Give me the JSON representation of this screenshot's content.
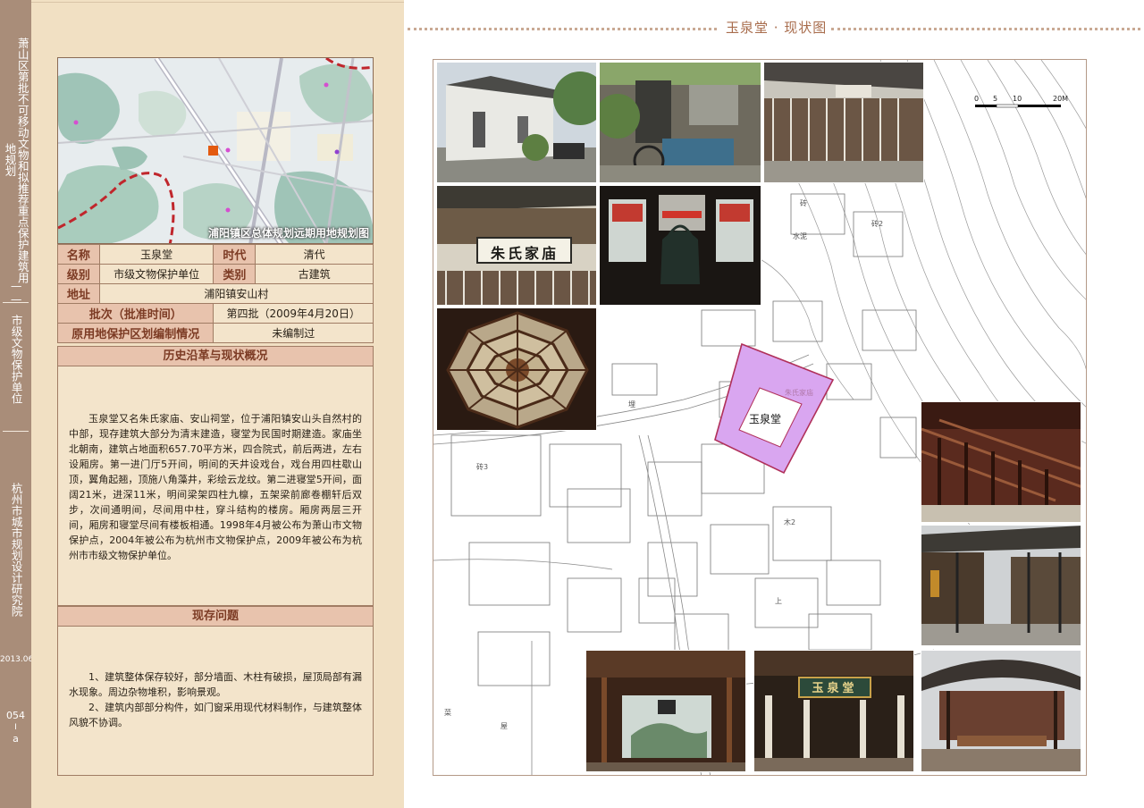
{
  "sidebar": {
    "series_title": "萧山区第批不可移动文物和拟推荐重点保护建筑用地规划",
    "dash": "——",
    "category": "市级文物保护单位",
    "institute": "杭州市城市规划设计研究院",
    "date": "2013.06",
    "page_number": "054",
    "page_bar": "I",
    "page_suffix": "a"
  },
  "map": {
    "caption": "浦阳镇区总体规划远期用地规划图"
  },
  "info": {
    "name_label": "名称",
    "name_value": "玉泉堂",
    "era_label": "时代",
    "era_value": "清代",
    "level_label": "级别",
    "level_value": "市级文物保护单位",
    "type_label": "类别",
    "type_value": "古建筑",
    "address_label": "地址",
    "address_value": "浦阳镇安山村",
    "batch_label": "批次（批准时间）",
    "batch_value": "第四批（2009年4月20日）",
    "plan_label": "原用地保护区划编制情况",
    "plan_value": "未编制过"
  },
  "history": {
    "heading": "历史沿革与现状概况",
    "text": "玉泉堂又名朱氏家庙、安山祠堂，位于浦阳镇安山头自然村的中部，现存建筑大部分为清末建造，寝堂为民国时期建造。家庙坐北朝南，建筑占地面积657.70平方米，四合院式，前后两进，左右设厢房。第一进门厅5开间，明间的天井设戏台，戏台用四柱歇山顶，翼角起翘，顶施八角藻井，彩绘云龙纹。第二进寝堂5开间，面阔21米，进深11米，明间梁架四柱九檩，五架梁前廊卷棚轩后双步，次间通明间，尽间用中柱，穿斗结构的楼房。厢房两层三开间，厢房和寝堂尽间有楼板相通。1998年4月被公布为萧山市文物保护点，2004年被公布为杭州市文物保护点，2009年被公布为杭州市市级文物保护单位。"
  },
  "issues": {
    "heading": "现存问题",
    "item1": "1、建筑整体保存较好，部分墙面、木柱有破损，屋顶局部有漏水现象。周边杂物堆积，影响景观。",
    "item2": "2、建筑内部部分构件，如门窗采用现代材料制作，与建筑整体风貌不协调。"
  },
  "right": {
    "title": "玉泉堂 · 现状图",
    "site_label": "玉泉堂",
    "site_note": "朱氏家庙",
    "scale_labels": [
      "0",
      "5",
      "10",
      "20M"
    ],
    "plaque1": "朱氏家庙",
    "plaque2": "玉泉堂",
    "plan_labels": [
      "水泥",
      "砖",
      "砖2",
      "砖3",
      "木2",
      "上",
      "埋",
      "菜",
      "屋"
    ]
  },
  "colors": {
    "strip": "#a98d79",
    "page_bg": "#f1e0c3",
    "header_cell": "#e8c3ad",
    "header_text": "#7c3b24",
    "site_fill": "#d9a6f0",
    "site_stroke": "#b0305a",
    "title_color": "#a86c4c"
  }
}
